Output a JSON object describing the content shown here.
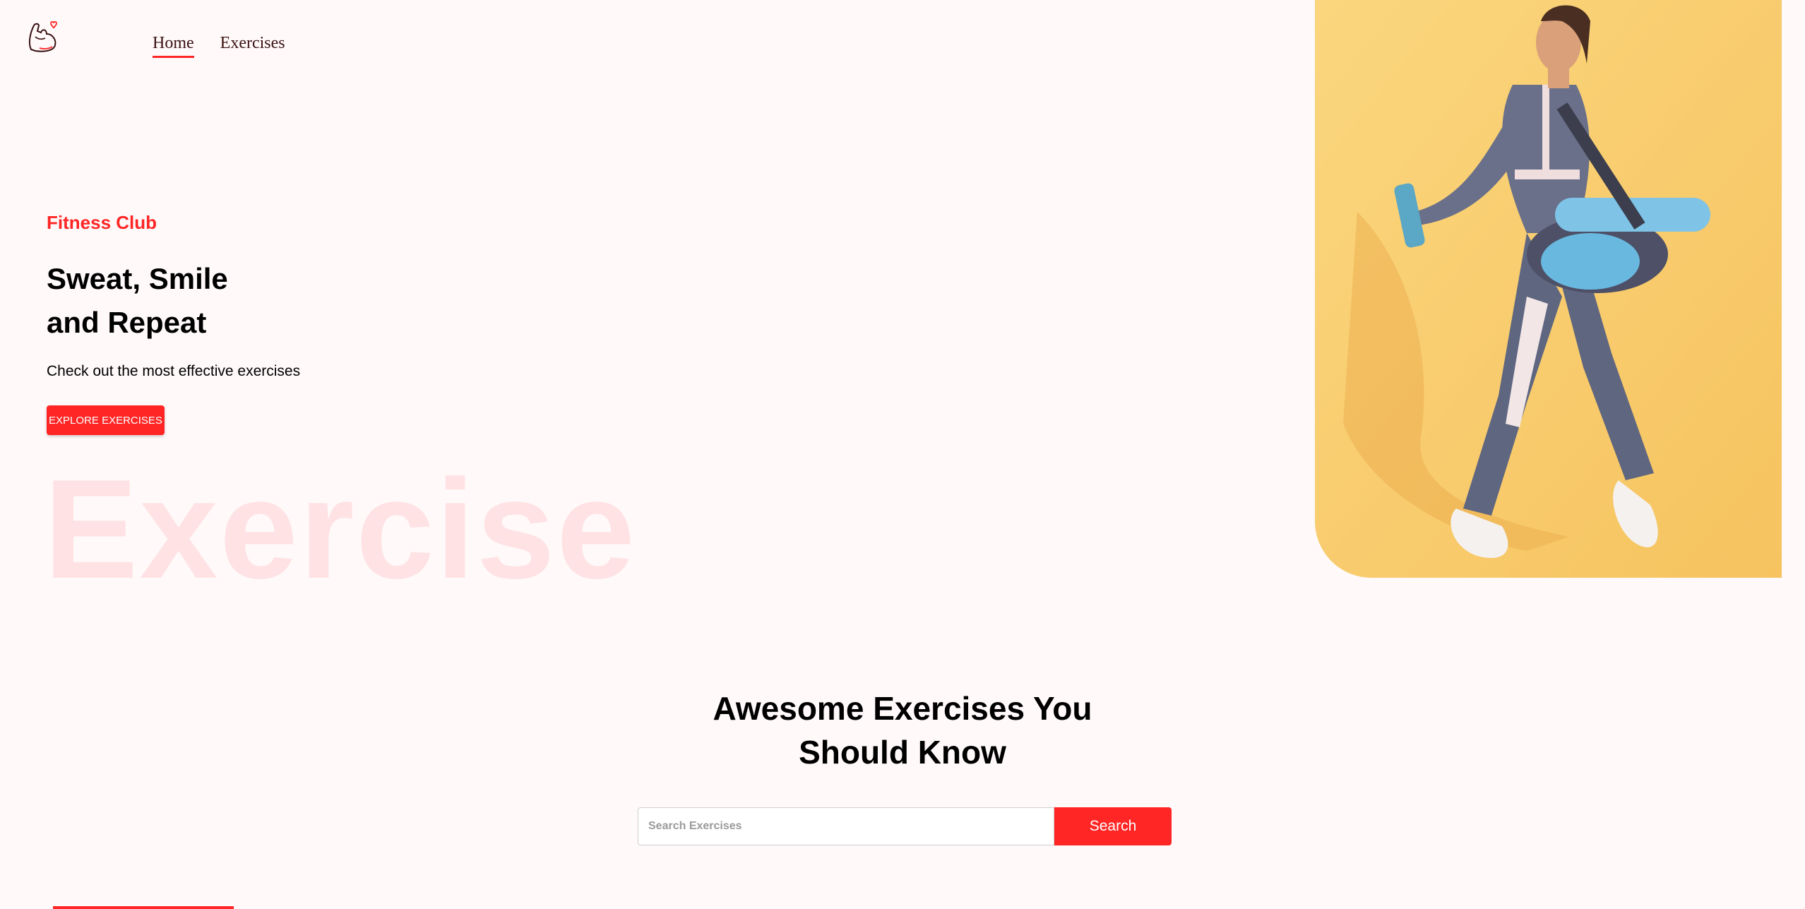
{
  "nav": {
    "logo_icon": "flexed-arm-heart-icon",
    "links": [
      {
        "label": "Home",
        "active": true
      },
      {
        "label": "Exercises",
        "active": false
      }
    ]
  },
  "hero": {
    "subtitle": "Fitness Club",
    "title_line1": "Sweat, Smile",
    "title_line2": "and Repeat",
    "description": "Check out the most effective exercises",
    "cta_label": "EXPLORE EXERCISES",
    "background_word": "Exercise"
  },
  "banner": {
    "image": "woman-walking-with-gym-bag-yoga-mat-and-shaker-bottle",
    "background_color": "#f8ca6c"
  },
  "search": {
    "title_line1": "Awesome Exercises You",
    "title_line2": "Should Know",
    "placeholder": "Search Exercises",
    "value": "",
    "button_label": "Search"
  },
  "colors": {
    "accent": "#ff2625",
    "page_background": "#fff9fa"
  }
}
